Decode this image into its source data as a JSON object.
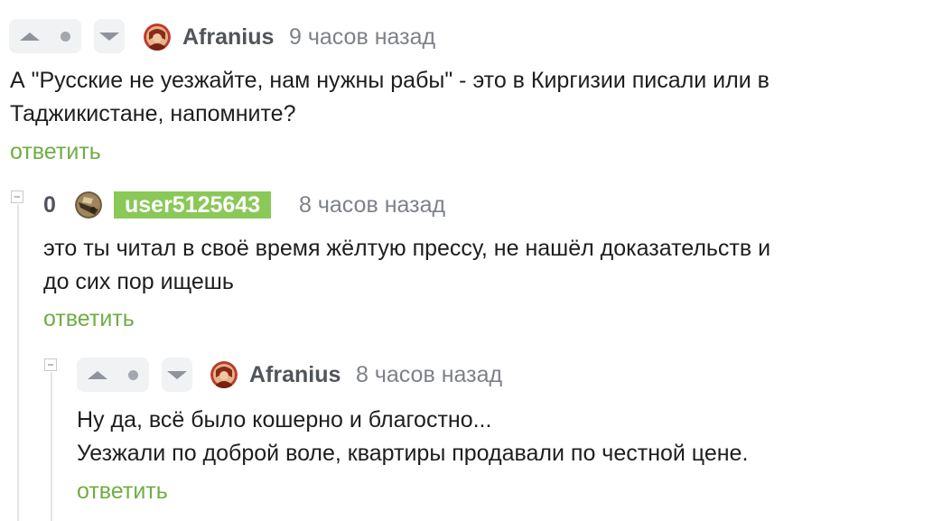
{
  "comments": [
    {
      "author": "Afranius",
      "time": "9 часов назад",
      "lines": [
        "А \"Русские не уезжайте, нам нужны рабы\" - это в Киргизии писали или в",
        "Таджикистане, напомните?"
      ],
      "reply_label": "ответить"
    },
    {
      "rating": "0",
      "author": "user5125643",
      "time": "8 часов назад",
      "lines": [
        "это ты читал в своё время жёлтую прессу, не нашёл доказательств и",
        "до сих пор ищешь"
      ],
      "reply_label": "ответить"
    },
    {
      "author": "Afranius",
      "time": "8 часов назад",
      "lines": [
        "Ну да, всё было кошерно и благостно...",
        "Уезжали по доброй воле, квартиры продавали по честной цене."
      ],
      "reply_label": "ответить"
    }
  ],
  "colors": {
    "reply": "#6fae43",
    "user_badge": "#8ac858",
    "vote_bg": "#f1f2f4"
  },
  "icons": {
    "upvote": "triangle-up",
    "downvote": "triangle-down",
    "collapse": "minus-box"
  }
}
